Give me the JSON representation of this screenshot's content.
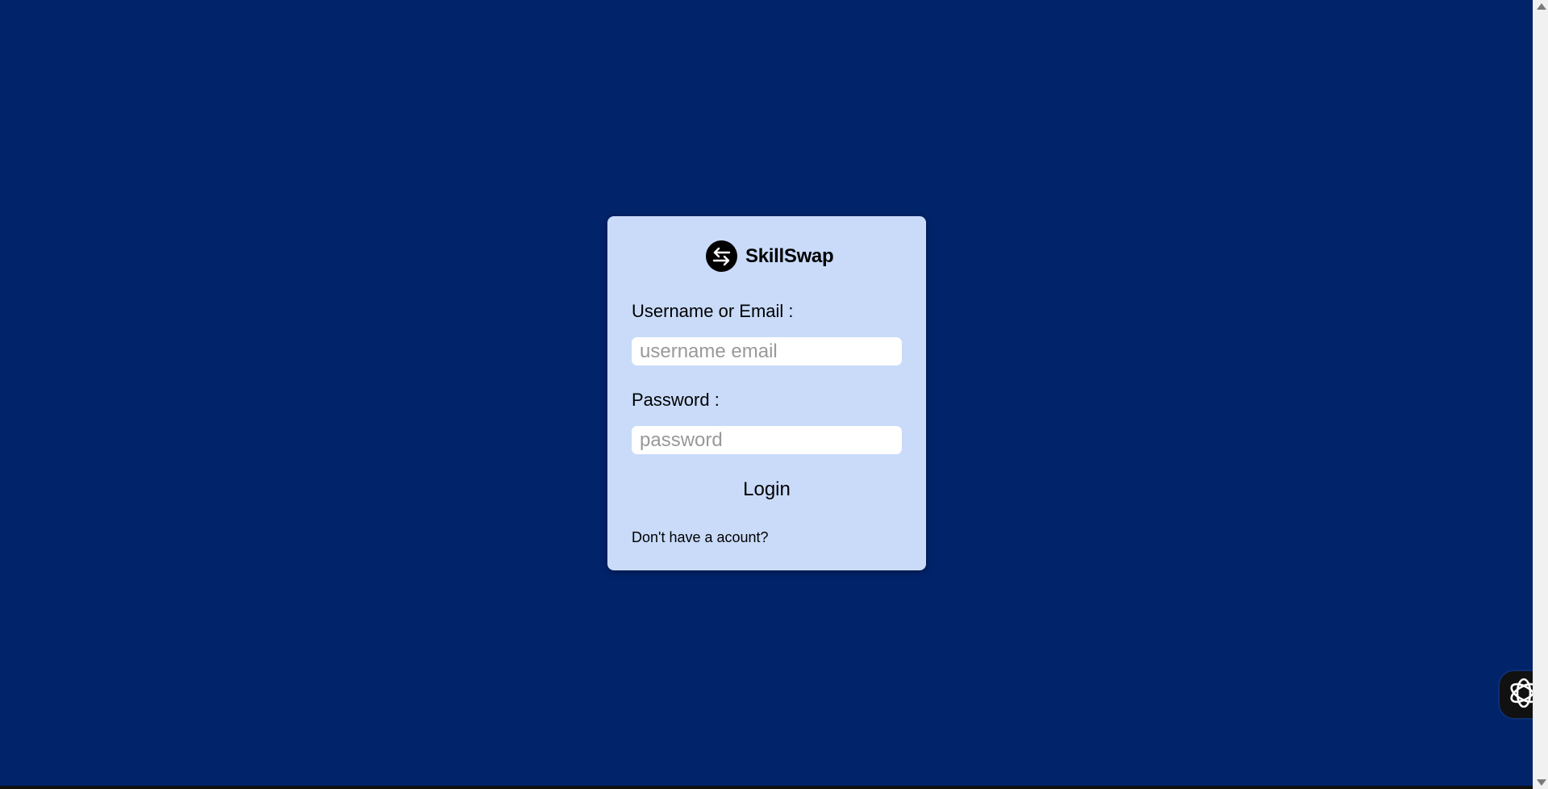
{
  "app": {
    "brand_name": "SkillSwap",
    "brand_icon": "swap-arrows-icon"
  },
  "form": {
    "username_label": "Username or Email :",
    "username_placeholder": "username email",
    "username_value": "",
    "password_label": "Password :",
    "password_placeholder": "password",
    "password_value": "",
    "login_label": "Login",
    "signup_text": "Don't have a acount?"
  },
  "widgets": {
    "assistant_icon": "openai-knot-icon"
  },
  "colors": {
    "background": "#00236a",
    "card": "#c9dbf9",
    "input": "#ffffff",
    "text": "#000000",
    "placeholder": "#999999"
  }
}
